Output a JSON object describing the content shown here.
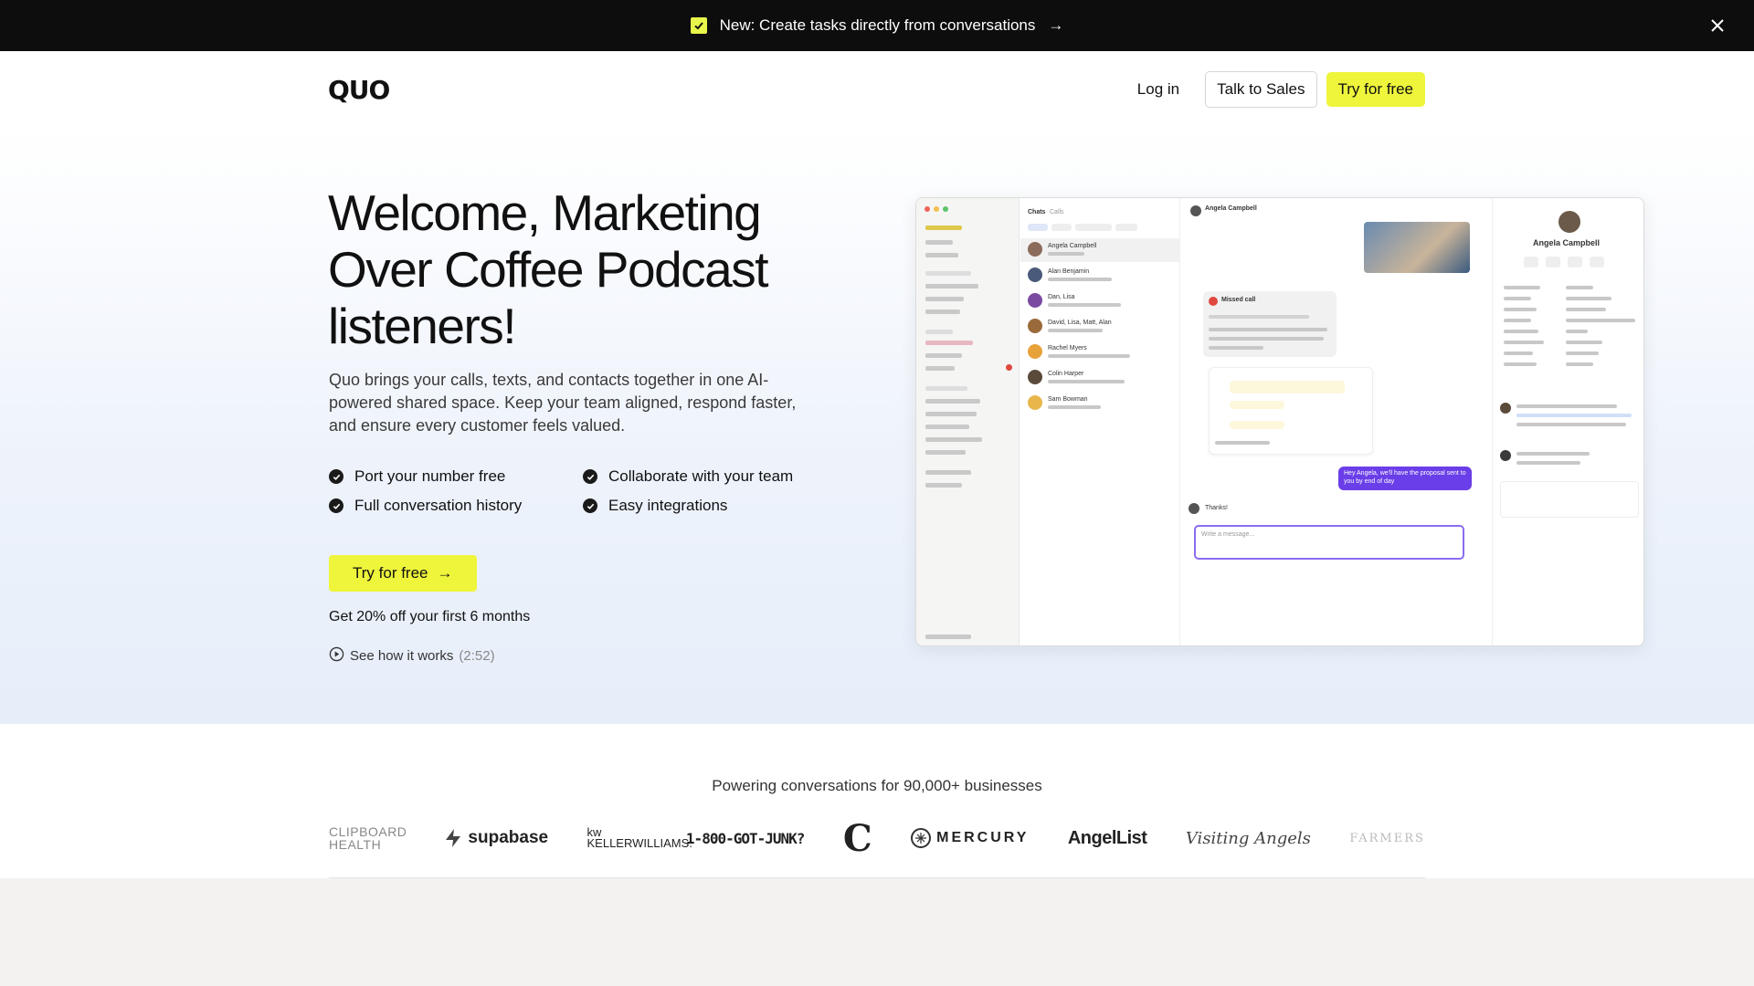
{
  "announcement": {
    "text": "New: Create tasks directly from conversations",
    "arrow": "→"
  },
  "header": {
    "logo": "QUO",
    "login": "Log in",
    "talk_to_sales": "Talk to Sales",
    "try_free": "Try for free"
  },
  "hero": {
    "title": "Welcome, Marketing Over Coffee Podcast listeners!",
    "subtitle": "Quo brings your calls, texts, and contacts together in one AI-powered shared space. Keep your team aligned, respond faster, and ensure every customer feels valued.",
    "features": [
      "Port your number free",
      "Collaborate with your team",
      "Full conversation history",
      "Easy integrations"
    ],
    "cta": "Try for free",
    "cta_arrow": "→",
    "discount": "Get 20% off your first 6 months",
    "how_it_works": "See how it works",
    "duration": "(2:52)"
  },
  "app_preview": {
    "profile_name": "Angela Campbell",
    "chat_header_name": "Angela Campbell",
    "tab_chats": "Chats",
    "tab_calls": "Calls",
    "missed_call": "Missed call",
    "thanks": "Thanks!",
    "composer_placeholder": "Write a message...",
    "outgoing_message": "Hey Angela, we'll have the proposal sent to you by end of day",
    "conversations": [
      "Angela Campbell",
      "Alan Benjamin",
      "Dan, Lisa",
      "David, Lisa, Matt, Alan",
      "Rachel Myers",
      "Colin Harper",
      "Sam Bowman"
    ]
  },
  "social_proof": {
    "heading": "Powering conversations for 90,000+ businesses",
    "logos": [
      "CLIPBOARD HEALTH",
      "supabase",
      "kw KELLERWILLIAMS.",
      "1-800-GOT-JUNK?",
      "C",
      "MERCURY",
      "AngelList",
      "Visiting Angels",
      "FARMERS"
    ]
  },
  "colors": {
    "accent_yellow": "#eef53b",
    "announcement_bg": "#0d0d0d",
    "hero_gradient_end": "#e6eefa"
  }
}
